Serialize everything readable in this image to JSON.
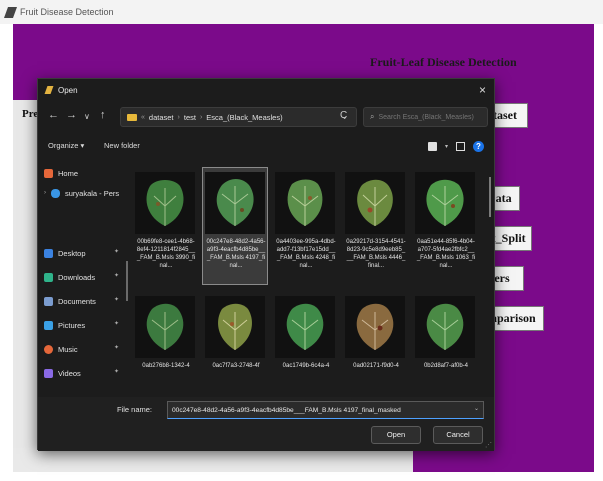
{
  "app": {
    "window_title": "Fruit Disease Detection",
    "heading": "Fruit-Leaf Disease Detection",
    "left_label": "Pre",
    "buttons": [
      "ataset",
      "Data",
      "st_Split",
      "fiers",
      "mparison"
    ],
    "background_color": "#7b0a8a"
  },
  "dialog": {
    "title": "Open",
    "close_icon": "×",
    "nav": {
      "back": "←",
      "forward": "→",
      "recent": "∨",
      "up": "↑"
    },
    "breadcrumb": [
      "«",
      "dataset",
      "›",
      "test",
      "›",
      "Esca_(Black_Measles)"
    ],
    "refresh_icon": "C",
    "search_placeholder": "Search Esca_(Black_Measles)",
    "commands": {
      "organize": "Organize ▾",
      "new_folder": "New folder"
    },
    "sidebar": [
      {
        "label": "Home",
        "icon": "home-icon",
        "color": "#e5673a"
      },
      {
        "label": "suryakala - Pers",
        "icon": "cloud-icon",
        "color": "#3a96e5"
      },
      {
        "label": "Desktop",
        "icon": "desktop-icon",
        "color": "#3b82e0"
      },
      {
        "label": "Downloads",
        "icon": "download-icon",
        "color": "#2fb38a"
      },
      {
        "label": "Documents",
        "icon": "document-icon",
        "color": "#7b9ccf"
      },
      {
        "label": "Pictures",
        "icon": "pictures-icon",
        "color": "#3aa0e5"
      },
      {
        "label": "Music",
        "icon": "music-icon",
        "color": "#e5673a"
      },
      {
        "label": "Videos",
        "icon": "video-icon",
        "color": "#8a6ae5"
      }
    ],
    "files": [
      {
        "name": "00b69fe8-cee1-4b68-8ef4-1211814f2845___FAM_B.Msls 3990_final...",
        "selected": false
      },
      {
        "name": "00c247e8-48d2-4a56-a9f3-4eacfb4d85be___FAM_B.Msls 4197_final...",
        "selected": true
      },
      {
        "name": "0a4403ee-995a-4dbd-add7-f13bf17e15dd___FAM_B.Msls 4248_final...",
        "selected": false
      },
      {
        "name": "0a29217d-3154-4541-8d23-9c5e8d9eeb85___FAM_B.Msls 4446_final...",
        "selected": false
      },
      {
        "name": "0aa51e44-85f6-4b04-a707-5fd4ae2fbfc2___FAM_B.Msls 1063_final...",
        "selected": false
      },
      {
        "name": "0ab276b8-1342-4",
        "selected": false
      },
      {
        "name": "0ac7f7a3-2748-4f",
        "selected": false
      },
      {
        "name": "0ac1749b-6c4a-4",
        "selected": false
      },
      {
        "name": "0ad02171-f9d0-4",
        "selected": false
      },
      {
        "name": "0b2d8af7-af0b-4",
        "selected": false
      }
    ],
    "file_name_label": "File name:",
    "file_name_value": "00c247e8-48d2-4a56-a9f3-4eacfb4d85be___FAM_B.Msls 4197_final_masked",
    "open_label": "Open",
    "cancel_label": "Cancel"
  }
}
